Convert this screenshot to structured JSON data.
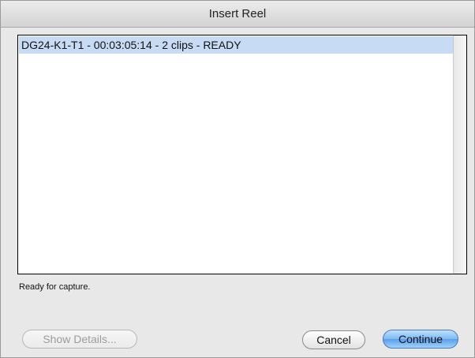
{
  "window": {
    "title": "Insert Reel"
  },
  "reel_list": {
    "items": [
      {
        "label": "DG24-K1-T1 - 00:03:05:14 - 2 clips - READY",
        "selected": true
      }
    ]
  },
  "status": {
    "text": "Ready for capture."
  },
  "buttons": {
    "show_details": "Show Details...",
    "cancel": "Cancel",
    "continue": "Continue"
  },
  "colors": {
    "selection": "#c7dbf4",
    "default_button": "#7eb8f3",
    "window_bg": "#e8e8e8"
  }
}
